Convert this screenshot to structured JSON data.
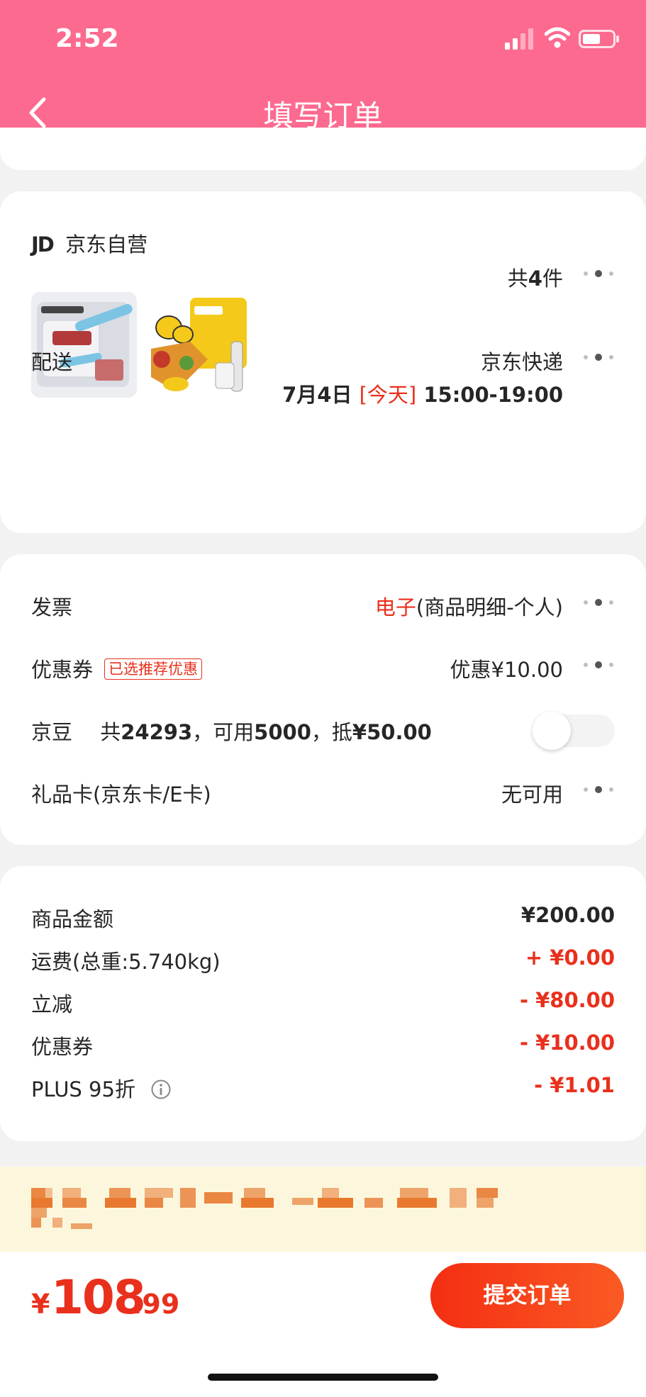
{
  "status_bar": {
    "time": "2:52"
  },
  "nav": {
    "title": "填写订单"
  },
  "store": {
    "logo": "JD",
    "name": "京东自营",
    "item_count_prefix": "共",
    "item_count": "4",
    "item_count_suffix": "件",
    "delivery_label": "配送",
    "delivery_method": "京东快递",
    "delivery_date": "7月4日",
    "delivery_today": "[今天]",
    "delivery_time": "15:00-19:00"
  },
  "options": {
    "invoice_label": "发票",
    "invoice_type": "电子",
    "invoice_detail": "(商品明细-个人)",
    "coupon_label": "优惠券",
    "coupon_tag": "已选推荐优惠",
    "coupon_value": "优惠¥10.00",
    "beans_label": "京豆",
    "beans_text_1": "共",
    "beans_total": "24293",
    "beans_text_2": "，可用",
    "beans_available": "5000",
    "beans_text_3": "，抵",
    "beans_deduct": "¥50.00",
    "beans_enabled": false,
    "giftcard_label": "礼品卡(京东卡/E卡)",
    "giftcard_value": "无可用"
  },
  "summary": {
    "rows": [
      {
        "label": "商品金额",
        "value": "¥200.00",
        "color": "#262626"
      },
      {
        "label": "运费(总重:5.740kg)",
        "value": "+ ¥0.00",
        "color": "#e9301c"
      },
      {
        "label": "立减",
        "value": "- ¥80.00",
        "color": "#e9301c"
      },
      {
        "label": "优惠券",
        "value": "- ¥10.00",
        "color": "#e9301c"
      },
      {
        "label": "PLUS 95折",
        "value": "- ¥1.01",
        "color": "#e9301c"
      }
    ]
  },
  "footer": {
    "currency": "¥",
    "total_int": "108",
    "total_dec": ".99",
    "submit_label": "提交订单"
  },
  "colors": {
    "brand_pink": "#fd6a8f",
    "price_red": "#e9301c",
    "notice_bg": "#fcf7dc"
  }
}
